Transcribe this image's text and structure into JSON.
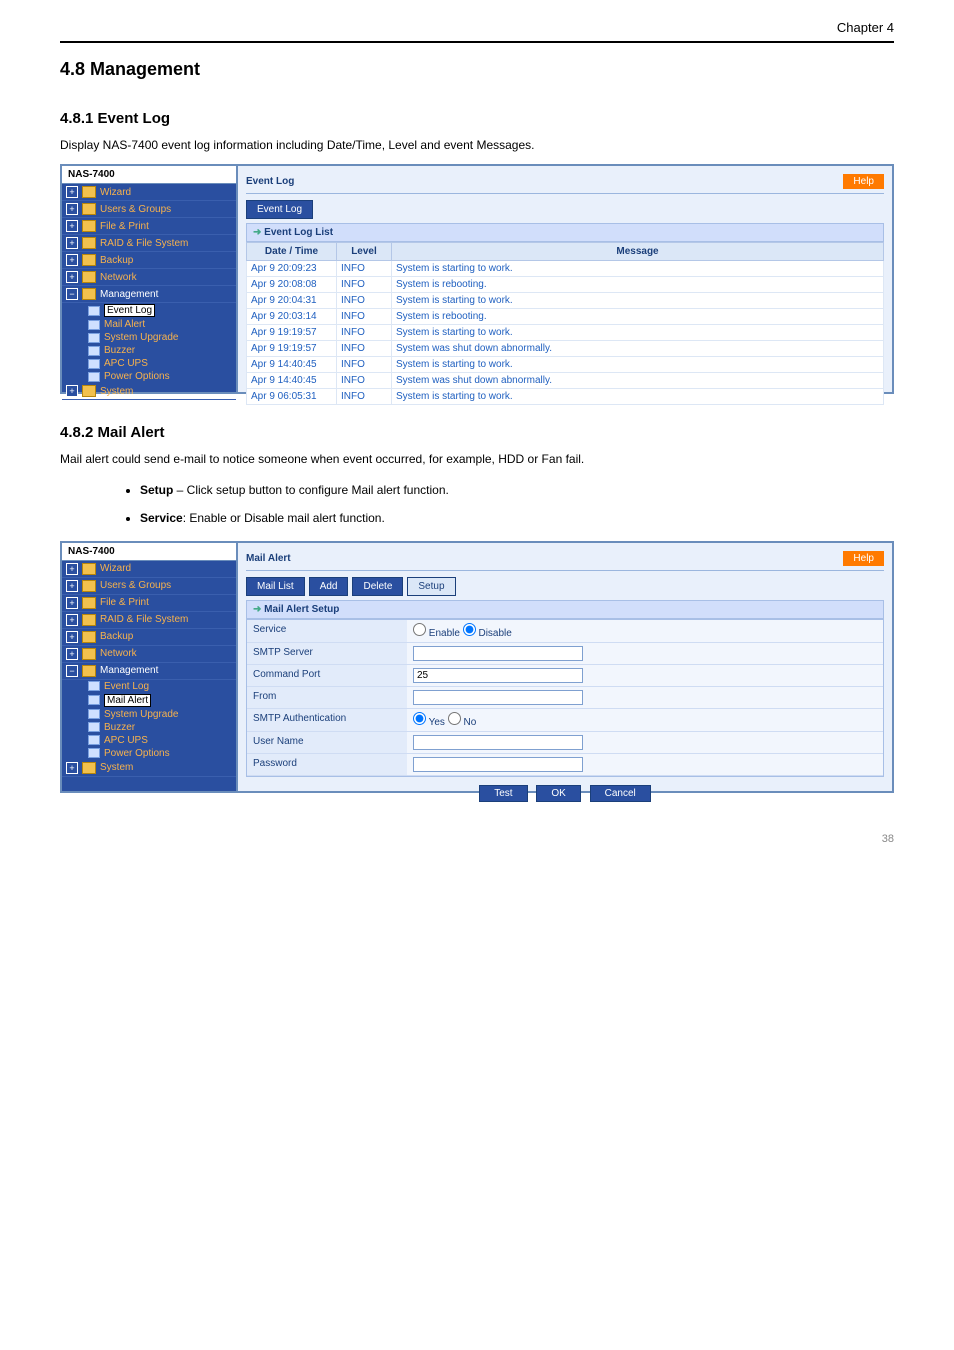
{
  "header_chapter": "Chapter 4",
  "section_management": "4.8 Management",
  "section_eventlog": "4.8.1 Event Log",
  "eventlog_para": "Display NAS-7400 event log information including Date/Time, Level and event Messages.",
  "device": "NAS-7400",
  "nav": {
    "wizard": "Wizard",
    "users": "Users & Groups",
    "fileprint": "File & Print",
    "raid": "RAID & File System",
    "backup": "Backup",
    "network": "Network",
    "management": "Management",
    "system": "System",
    "sub_eventlog": "Event Log",
    "sub_mail": "Mail Alert",
    "sub_upgrade": "System Upgrade",
    "sub_buzzer": "Buzzer",
    "sub_apc": "APC UPS",
    "sub_power": "Power Options"
  },
  "help": "Help",
  "s1": {
    "title": "Event Log",
    "tab": "Event Log",
    "list_title": "Event Log List",
    "col_date": "Date / Time",
    "col_level": "Level",
    "col_msg": "Message",
    "rows": [
      {
        "d": "Apr 9 20:09:23",
        "l": "INFO",
        "m": "System is starting to work."
      },
      {
        "d": "Apr 9 20:08:08",
        "l": "INFO",
        "m": "System is rebooting."
      },
      {
        "d": "Apr 9 20:04:31",
        "l": "INFO",
        "m": "System is starting to work."
      },
      {
        "d": "Apr 9 20:03:14",
        "l": "INFO",
        "m": "System is rebooting."
      },
      {
        "d": "Apr 9 19:19:57",
        "l": "INFO",
        "m": "System is starting to work."
      },
      {
        "d": "Apr 9 19:19:57",
        "l": "INFO",
        "m": "System was shut down abnormally."
      },
      {
        "d": "Apr 9 14:40:45",
        "l": "INFO",
        "m": "System is starting to work."
      },
      {
        "d": "Apr 9 14:40:45",
        "l": "INFO",
        "m": "System was shut down abnormally."
      },
      {
        "d": "Apr 9 06:05:31",
        "l": "INFO",
        "m": "System is starting to work."
      }
    ]
  },
  "section_mail": "4.8.2 Mail Alert",
  "mail_para": "Mail alert could send e-mail to notice someone when event occurred, for example, HDD or Fan fail.",
  "bullet_setup_t": "Setup",
  "bullet_setup": " – Click setup button to configure Mail alert function.",
  "bullet_service_t": "Service",
  "bullet_service": ": Enable or Disable mail alert function.",
  "s2": {
    "title": "Mail Alert",
    "tab_list": "Mail List",
    "tab_add": "Add",
    "tab_del": "Delete",
    "tab_setup": "Setup",
    "list_title": "Mail Alert Setup",
    "f_service": "Service",
    "v_service_en": "Enable",
    "v_service_di": "Disable",
    "f_smtp": "SMTP Server",
    "f_port": "Command Port",
    "v_port": "25",
    "f_from": "From",
    "f_auth": "SMTP Authentication",
    "v_auth_y": "Yes",
    "v_auth_n": "No",
    "f_user": "User Name",
    "f_pass": "Password",
    "b_test": "Test",
    "b_ok": "OK",
    "b_cancel": "Cancel"
  },
  "pageno": "38"
}
